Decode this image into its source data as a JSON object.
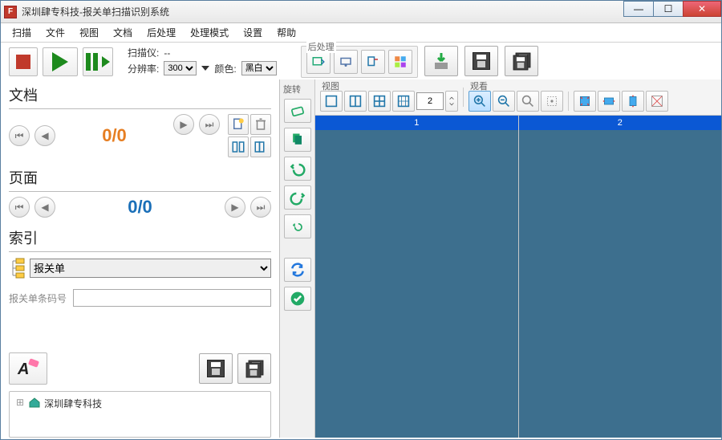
{
  "window": {
    "title": "深圳肆专科技-报关单扫描识别系统"
  },
  "menu": [
    "扫描",
    "文件",
    "视图",
    "文档",
    "后处理",
    "处理模式",
    "设置",
    "帮助"
  ],
  "scan": {
    "scanner_label": "扫描仪:",
    "scanner_value": "--",
    "res_label": "分辨率:",
    "res_value": "300",
    "color_label": "颜色:",
    "color_value": "黑白"
  },
  "groups": {
    "postproc": "后处理",
    "rotate": "旋转",
    "view": "视图",
    "look": "观看"
  },
  "left": {
    "doc_title": "文档",
    "doc_counter": "0/0",
    "page_title": "页面",
    "page_counter": "0/0",
    "index_title": "索引",
    "index_value": "报关单",
    "barcode_label": "报关单条码号",
    "barcode_value": ""
  },
  "tree": {
    "root": "深圳肆专科技"
  },
  "viewer": {
    "layout_value": "2",
    "page1": "1",
    "page2": "2"
  }
}
